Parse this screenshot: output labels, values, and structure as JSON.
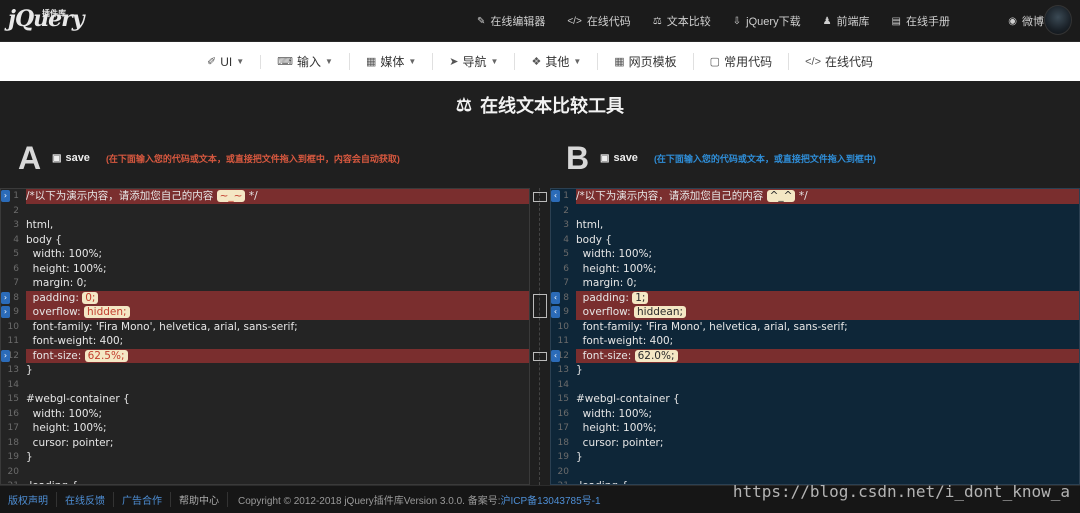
{
  "logo": {
    "text": "jQuery",
    "sub": "插件库"
  },
  "topnav": [
    {
      "icon": "edit-icon",
      "glyph": "✎",
      "label": "在线编辑器"
    },
    {
      "icon": "code-icon",
      "glyph": "</>",
      "label": "在线代码"
    },
    {
      "icon": "scale-icon",
      "glyph": "⚖",
      "label": "文本比较"
    },
    {
      "icon": "download-icon",
      "glyph": "⇩",
      "label": "jQuery下载"
    },
    {
      "icon": "user-icon",
      "glyph": "♟",
      "label": "前端库"
    },
    {
      "icon": "book-icon",
      "glyph": "▤",
      "label": "在线手册"
    },
    {
      "icon": "weibo-icon",
      "glyph": "◉",
      "label": "微博"
    }
  ],
  "subnav": [
    {
      "icon": "brush-icon",
      "glyph": "✐",
      "label": "UI",
      "caret": true
    },
    {
      "icon": "keyboard-icon",
      "glyph": "⌨",
      "label": "输入",
      "caret": true
    },
    {
      "icon": "film-icon",
      "glyph": "▦",
      "label": "媒体",
      "caret": true
    },
    {
      "icon": "send-icon",
      "glyph": "➤",
      "label": "导航",
      "caret": true
    },
    {
      "icon": "dropbox-icon",
      "glyph": "❖",
      "label": "其他",
      "caret": true
    },
    {
      "icon": "grid-icon",
      "glyph": "▦",
      "label": "网页模板",
      "caret": false
    },
    {
      "icon": "file-icon",
      "glyph": "▢",
      "label": "常用代码",
      "caret": false
    },
    {
      "icon": "code-icon",
      "glyph": "</>",
      "label": "在线代码",
      "caret": false
    }
  ],
  "title": {
    "glyph": "⚖",
    "text": "在线文本比较工具"
  },
  "panelA": {
    "letter": "A",
    "save": "save",
    "hint": "(在下面输入您的代码或文本，或直接把文件拖入到框中，内容会自动获取)",
    "lines": [
      {
        "n": "1",
        "pre": "/*以下为演示内容，请添加您自己的内容 ",
        "mark": "~_~",
        "post": " */",
        "diff": true
      },
      {
        "n": "2",
        "pre": ""
      },
      {
        "n": "3",
        "pre": "html,"
      },
      {
        "n": "4",
        "pre": "body {"
      },
      {
        "n": "5",
        "pre": "  width: 100%;"
      },
      {
        "n": "6",
        "pre": "  height: 100%;"
      },
      {
        "n": "7",
        "pre": "  margin: 0;"
      },
      {
        "n": "8",
        "pre": "  padding: ",
        "mark": "0;",
        "post": "",
        "diff": true
      },
      {
        "n": "9",
        "pre": "  overflow: ",
        "mark": "hidden;",
        "post": "",
        "diff": true
      },
      {
        "n": "10",
        "pre": "  font-family: 'Fira Mono', helvetica, arial, sans-serif;"
      },
      {
        "n": "11",
        "pre": "  font-weight: 400;"
      },
      {
        "n": "12",
        "pre": "  font-size: ",
        "mark": "62.5%;",
        "post": "",
        "diff": true
      },
      {
        "n": "13",
        "pre": "}"
      },
      {
        "n": "14",
        "pre": ""
      },
      {
        "n": "15",
        "pre": "#webgl-container {"
      },
      {
        "n": "16",
        "pre": "  width: 100%;"
      },
      {
        "n": "17",
        "pre": "  height: 100%;"
      },
      {
        "n": "18",
        "pre": "  cursor: pointer;"
      },
      {
        "n": "19",
        "pre": "}"
      },
      {
        "n": "20",
        "pre": ""
      },
      {
        "n": "21",
        "pre": ".loading {"
      }
    ]
  },
  "panelB": {
    "letter": "B",
    "save": "save",
    "hint": "(在下面输入您的代码或文本，或直接把文件拖入到框中)",
    "lines": [
      {
        "n": "1",
        "pre": "/*以下为演示内容，请添加您自己的内容 ",
        "mark": "^_^",
        "post": " */",
        "diff": true
      },
      {
        "n": "2",
        "pre": ""
      },
      {
        "n": "3",
        "pre": "html,"
      },
      {
        "n": "4",
        "pre": "body {"
      },
      {
        "n": "5",
        "pre": "  width: 100%;"
      },
      {
        "n": "6",
        "pre": "  height: 100%;"
      },
      {
        "n": "7",
        "pre": "  margin: 0;"
      },
      {
        "n": "8",
        "pre": "  padding: ",
        "mark": "1;",
        "post": "",
        "diff": true
      },
      {
        "n": "9",
        "pre": "  overflow: ",
        "mark": "hiddean;",
        "post": "",
        "diff": true
      },
      {
        "n": "10",
        "pre": "  font-family: 'Fira Mono', helvetica, arial, sans-serif;"
      },
      {
        "n": "11",
        "pre": "  font-weight: 400;"
      },
      {
        "n": "12",
        "pre": "  font-size: ",
        "mark": "62.0%;",
        "post": "",
        "diff": true
      },
      {
        "n": "13",
        "pre": "}"
      },
      {
        "n": "14",
        "pre": ""
      },
      {
        "n": "15",
        "pre": "#webgl-container {"
      },
      {
        "n": "16",
        "pre": "  width: 100%;"
      },
      {
        "n": "17",
        "pre": "  height: 100%;"
      },
      {
        "n": "18",
        "pre": "  cursor: pointer;"
      },
      {
        "n": "19",
        "pre": "}"
      },
      {
        "n": "20",
        "pre": ""
      },
      {
        "n": "21",
        "pre": ".loading {"
      }
    ]
  },
  "footer": {
    "links": [
      "版权声明",
      "在线反馈",
      "广告合作"
    ],
    "plain": "帮助中心",
    "copyright": "Copyright © 2012-2018 jQuery插件库Version 3.0.0. 备案号:",
    "icp": "沪ICP备13043785号-1"
  },
  "watermark": "https://blog.csdn.net/i_dont_know_a",
  "colors": {
    "diff_bg": "#7a2e2e",
    "pane_b_bg": "#0e2638",
    "hint_a": "#d7583f",
    "hint_b": "#2f8ed8"
  }
}
